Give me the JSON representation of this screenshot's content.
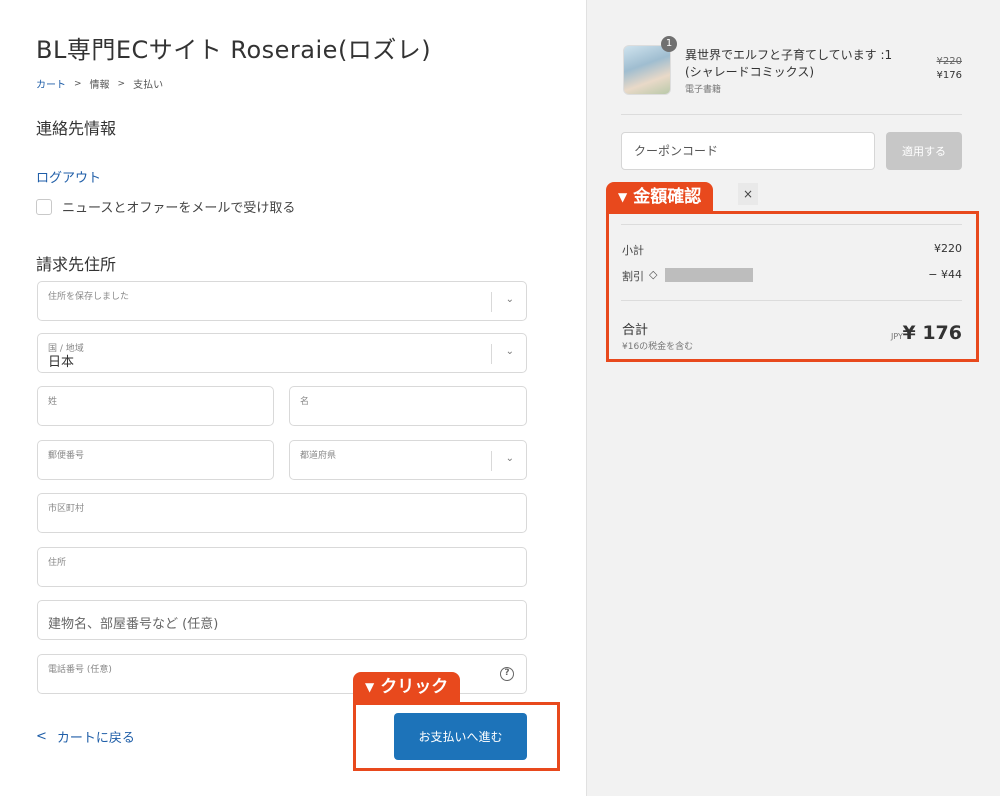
{
  "header": {
    "shop_title": "BL専門ECサイト Roseraie(ロズレ)",
    "breadcrumb": [
      "カート",
      "情報",
      "支払い"
    ],
    "breadcrumb_sep": ">"
  },
  "contact": {
    "title": "連絡先情報",
    "logout": "ログアウト",
    "newsletter_label": "ニュースとオファーをメールで受け取る"
  },
  "billing": {
    "title": "請求先住所",
    "saved_address_label": "住所を保存しました",
    "country_label": "国 / 地域",
    "country_value": "日本",
    "last_name_label": "姓",
    "first_name_label": "名",
    "postal_label": "郵便番号",
    "prefecture_label": "都道府県",
    "city_label": "市区町村",
    "address_label": "住所",
    "building_placeholder": "建物名、部屋番号など (任意)",
    "phone_label": "電話番号 (任意)"
  },
  "footer": {
    "back_label": "カートに戻る",
    "pay_button": "お支払いへ進む"
  },
  "callouts": {
    "click": "クリック",
    "amount": "金額確認"
  },
  "order": {
    "quantity": "1",
    "product_name": "異世界でエルフと子育てしています :1 (シャレードコミックス)",
    "product_category": "電子書籍",
    "price_original": "¥220",
    "price_current": "¥176",
    "coupon_placeholder": "クーポンコード",
    "apply_button": "適用する",
    "close": "×",
    "subtotal_label": "小計",
    "subtotal_value": "¥220",
    "discount_label": "割引",
    "discount_value": "− ¥44",
    "total_label": "合計",
    "tax_note": "¥16の税金を含む",
    "currency": "JPY",
    "total_value": "¥ 176"
  },
  "icons": {
    "chevron": "⌄",
    "help": "?",
    "back": "<",
    "tag": "◇",
    "triangle": "▼"
  },
  "colors": {
    "accent": "#1d73b9",
    "link": "#1f5ea8",
    "callout": "#e8491d"
  }
}
